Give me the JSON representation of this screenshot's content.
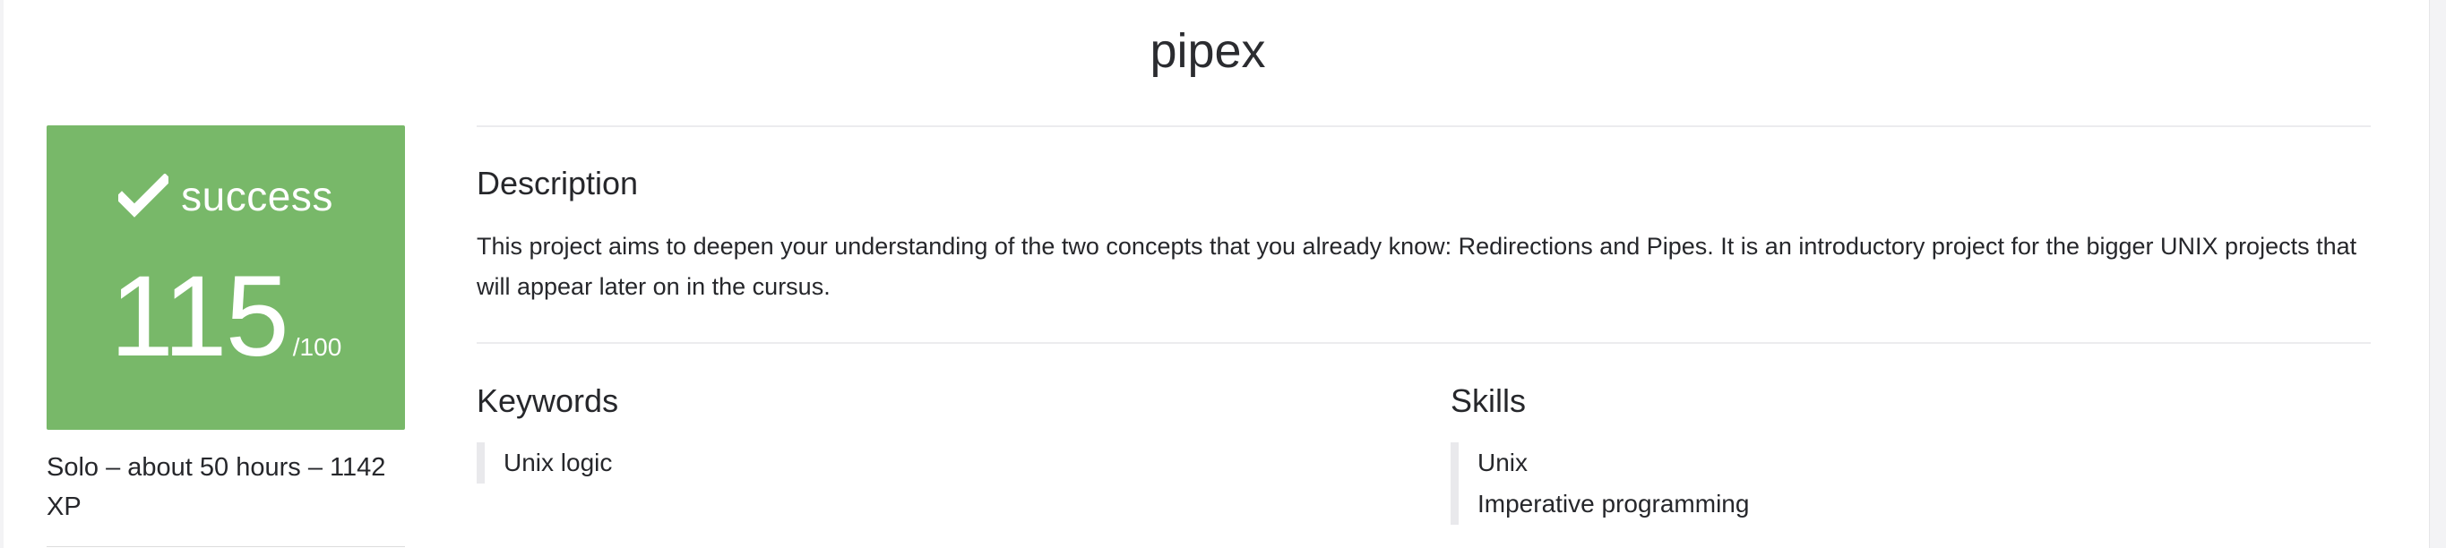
{
  "project": {
    "title": "pipex"
  },
  "result": {
    "status": "success",
    "score": "115",
    "max": "/100",
    "color": "#78b869"
  },
  "meta": {
    "text": "Solo – about 50 hours – 1142 XP"
  },
  "description": {
    "heading": "Description",
    "text": "This project aims to deepen your understanding of the two concepts that you already know: Redirections and Pipes. It is an introductory project for the bigger UNIX projects that will appear later on in the cursus."
  },
  "keywords": {
    "heading": "Keywords",
    "items": [
      "Unix logic"
    ]
  },
  "skills": {
    "heading": "Skills",
    "items": [
      "Unix",
      "Imperative programming"
    ]
  },
  "icons": {
    "status": "check-icon"
  }
}
